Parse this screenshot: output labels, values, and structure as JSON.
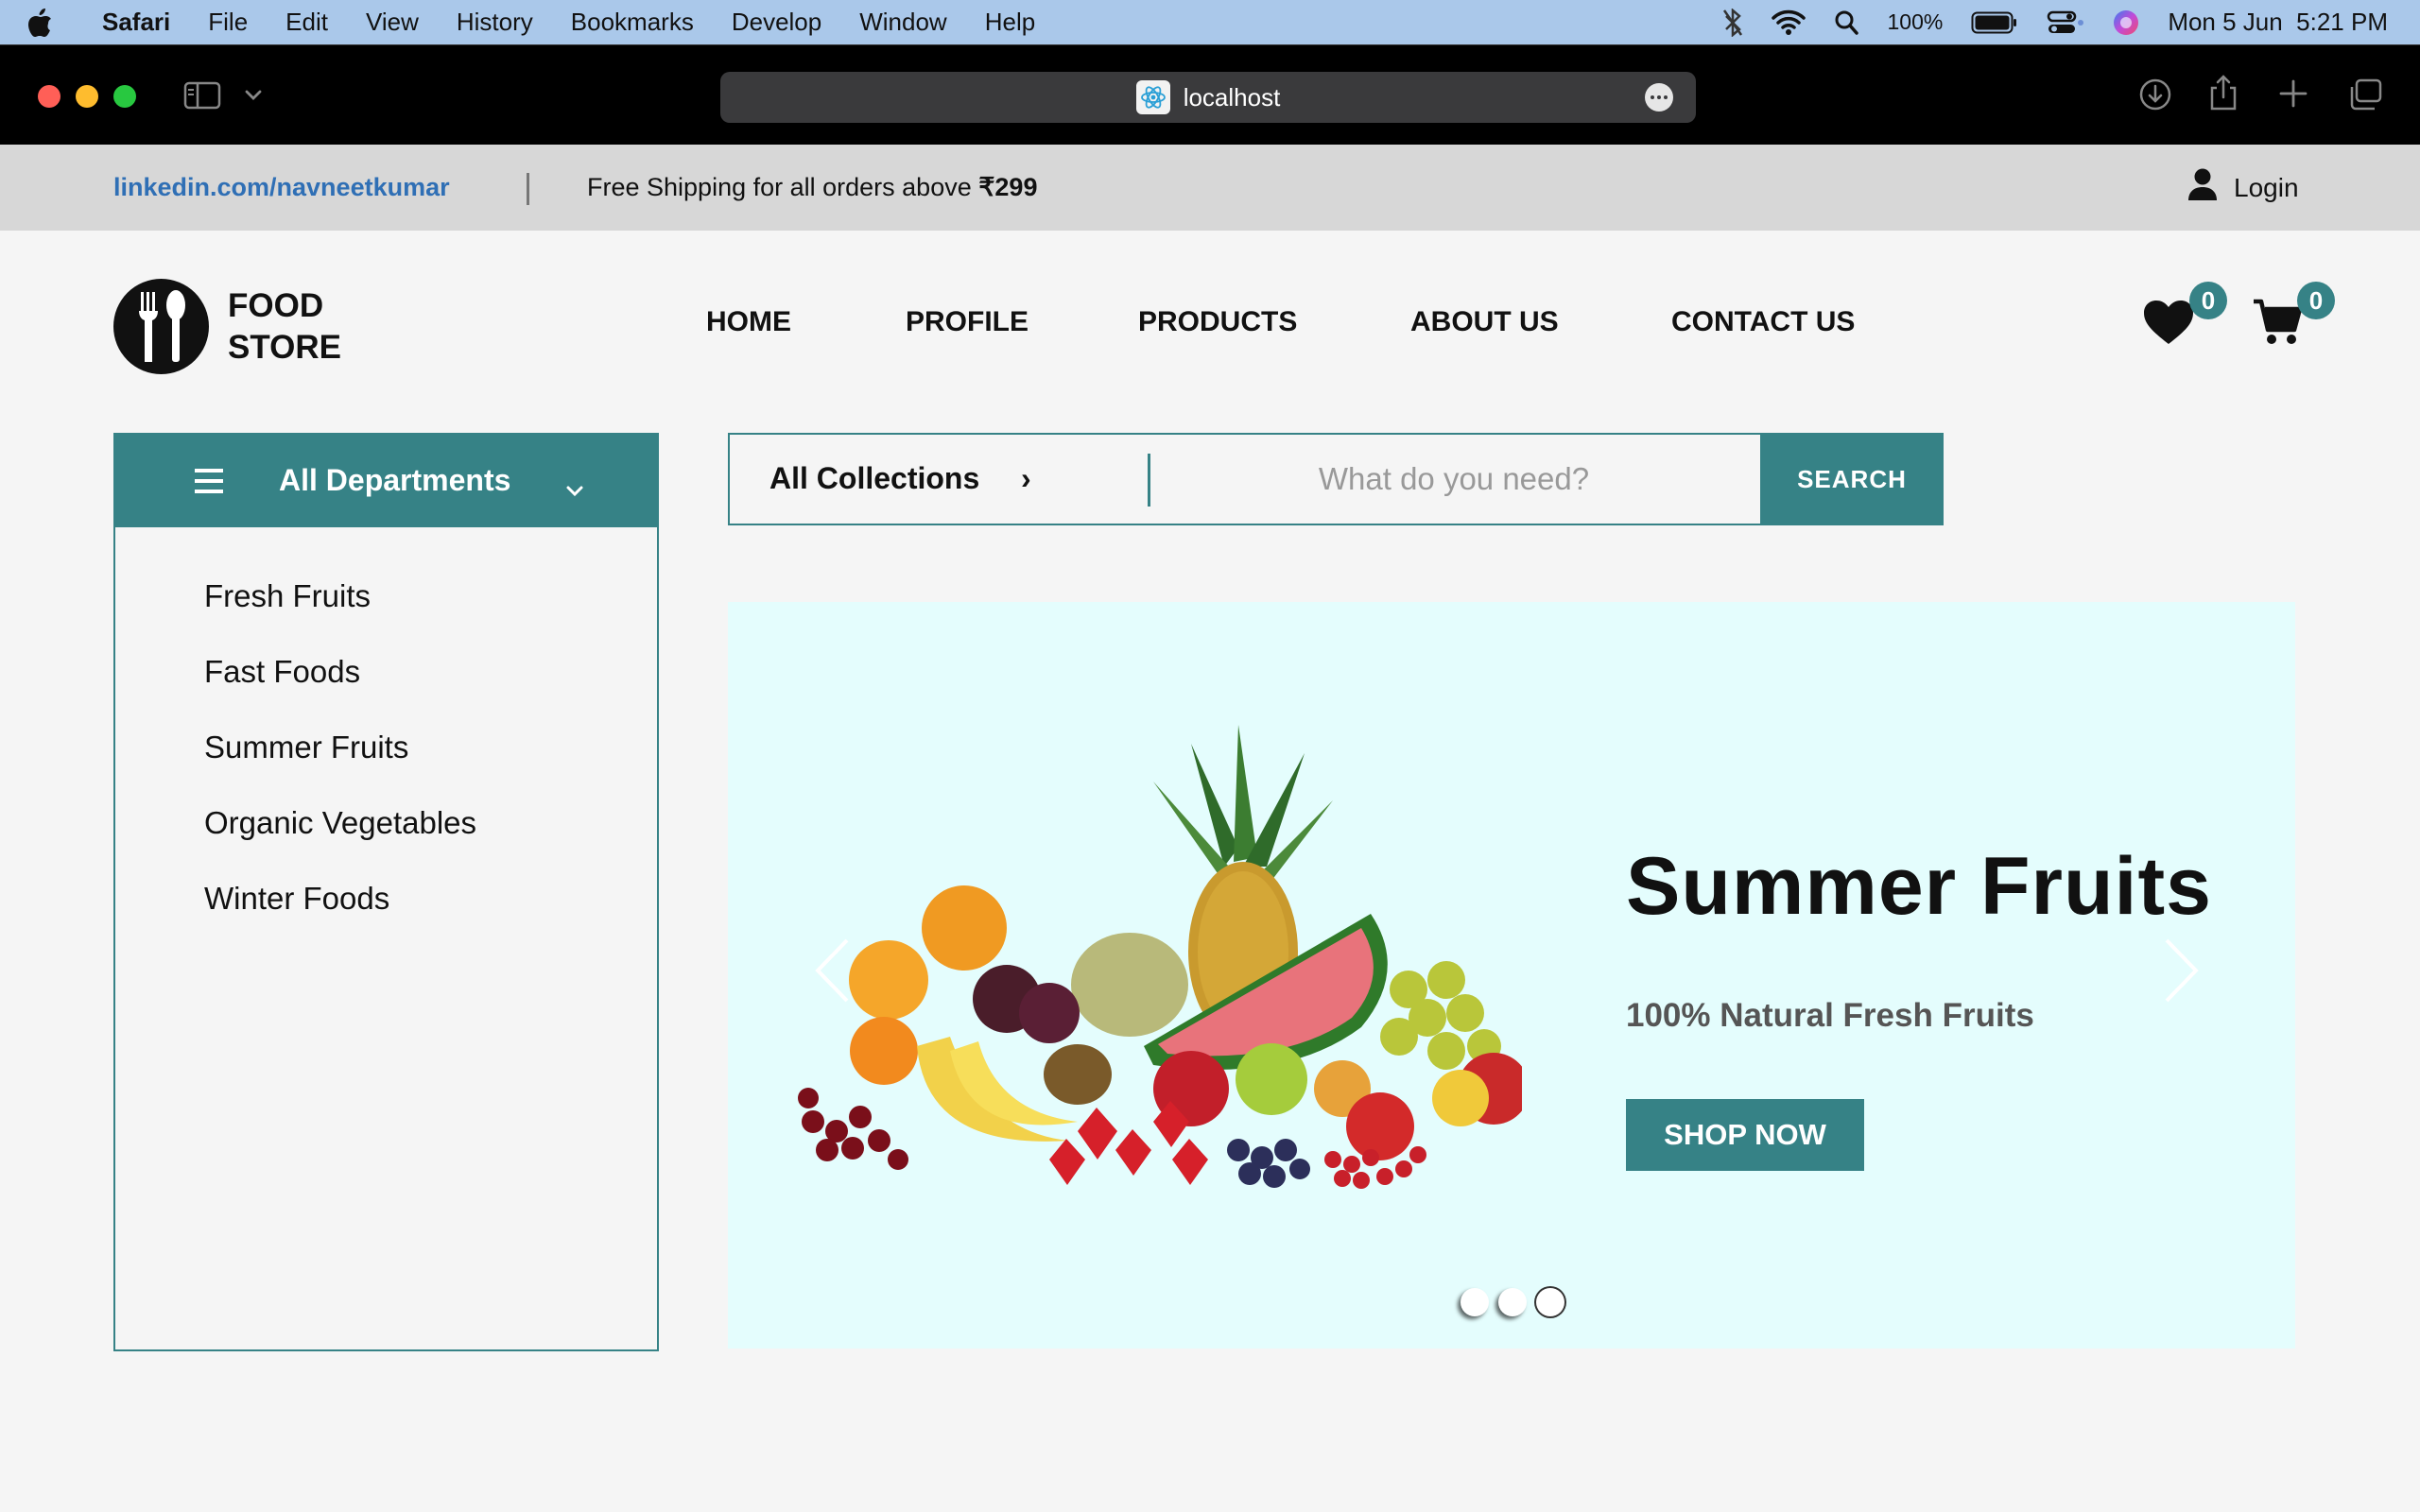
{
  "menubar": {
    "app": "Safari",
    "items": [
      "File",
      "Edit",
      "View",
      "History",
      "Bookmarks",
      "Develop",
      "Window",
      "Help"
    ],
    "battery": "100%",
    "datetime": "Mon 5 Jun  5:21 PM"
  },
  "browser": {
    "url": "localhost"
  },
  "topbar": {
    "link": "linkedin.com/navneetkumar",
    "shipping_text": "Free Shipping for all orders above ",
    "shipping_amount": "₹299",
    "login": "Login"
  },
  "header": {
    "logo_line1": "FOOD",
    "logo_line2": "STORE",
    "nav": [
      "HOME",
      "PROFILE",
      "PRODUCTS",
      "ABOUT US",
      "CONTACT US"
    ],
    "wishlist_count": "0",
    "cart_count": "0"
  },
  "departments": {
    "title": "All Departments",
    "items": [
      "Fresh Fruits",
      "Fast Foods",
      "Summer Fruits",
      "Organic Vegetables",
      "Winter Foods"
    ]
  },
  "search": {
    "collections": "All Collections",
    "placeholder": "What do you need?",
    "button": "SEARCH"
  },
  "hero": {
    "title": "Summer Fruits",
    "subtitle": "100% Natural Fresh Fruits",
    "cta": "SHOP NOW",
    "slides": 3,
    "active_slide": 3
  },
  "colors": {
    "accent": "#368286",
    "hero_bg": "#e4fdfd",
    "link": "#2f6fb5"
  }
}
